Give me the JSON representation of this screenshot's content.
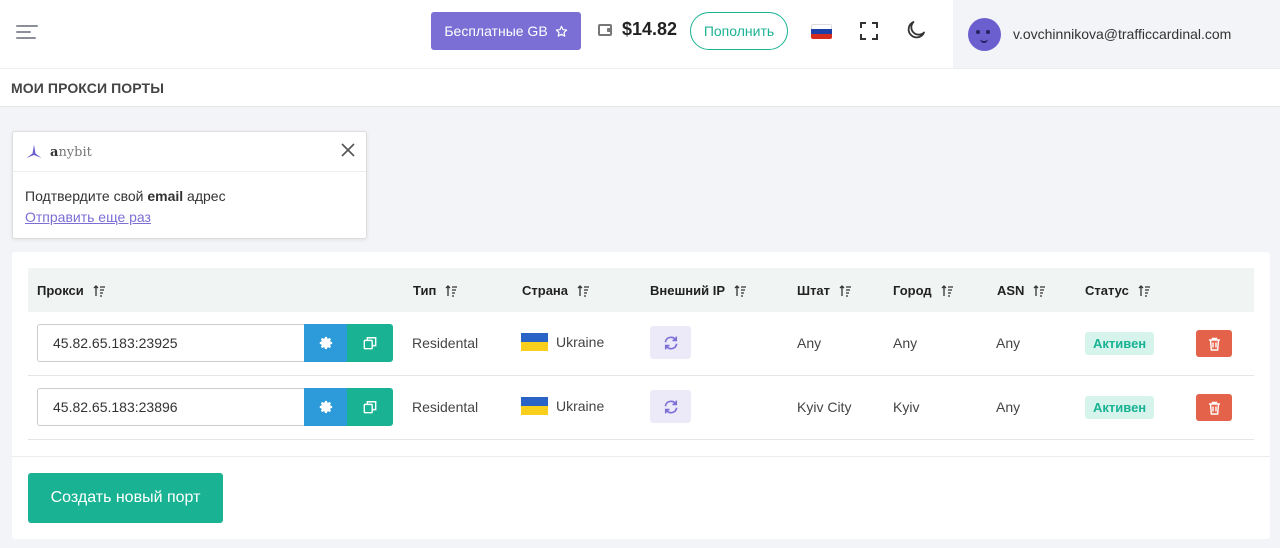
{
  "header": {
    "free_gb_label": "Бесплатные GB",
    "balance": "$14.82",
    "topup_label": "Пополнить",
    "user_email": "v.ovchinnikova@trafficcardinal.com"
  },
  "page": {
    "title": "МОИ ПРОКСИ ПОРТЫ"
  },
  "toast": {
    "brand_first": "a",
    "brand_rest": "nybit",
    "message_before": "Подтвердите свой ",
    "message_bold": "email",
    "message_after": " адрес",
    "link": "Отправить еще раз"
  },
  "table": {
    "columns": {
      "proxy": "Прокси",
      "type": "Тип",
      "country": "Страна",
      "external_ip": "Внешний IP",
      "state": "Штат",
      "city": "Город",
      "asn": "ASN",
      "status": "Статус"
    },
    "rows": [
      {
        "proxy": "45.82.65.183:23925",
        "type": "Residental",
        "country": "Ukraine",
        "state": "Any",
        "city": "Any",
        "asn": "Any",
        "status": "Активен"
      },
      {
        "proxy": "45.82.65.183:23896",
        "type": "Residental",
        "country": "Ukraine",
        "state": "Kyiv City",
        "city": "Kyiv",
        "asn": "Any",
        "status": "Активен"
      }
    ]
  },
  "create_button": "Создать новый порт",
  "colors": {
    "accent_purple": "#7b6fd6",
    "accent_green": "#19b394",
    "accent_blue": "#2d9ad9",
    "danger": "#e4624a"
  }
}
